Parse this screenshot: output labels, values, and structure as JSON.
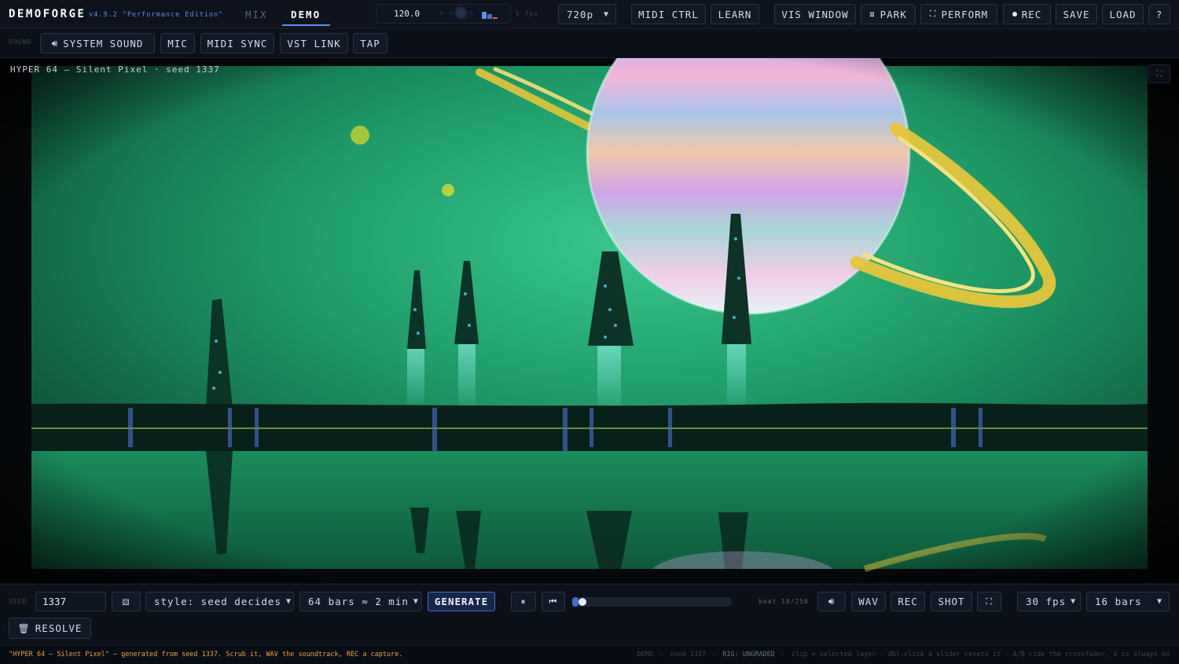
{
  "app": {
    "name": "DEMOFORGE",
    "version": "v4.9.2 \"Performance Edition\""
  },
  "mode_tabs": [
    {
      "label": "MIX",
      "active": false
    },
    {
      "label": "DEMO",
      "active": true
    }
  ],
  "tempo": {
    "bpm": "120.0",
    "fps_readout": "5 fps"
  },
  "resolution": {
    "selected": "720p"
  },
  "top_buttons": {
    "midi_ctrl": "MIDI CTRL",
    "learn": "LEARN",
    "vis_window": "VIS WINDOW",
    "park": "PARK",
    "perform": "PERFORM",
    "rec": "REC",
    "save": "SAVE",
    "load": "LOAD",
    "help": "?"
  },
  "sound_row": {
    "label": "SOUND",
    "system_sound": "SYSTEM SOUND",
    "mic": "MIC",
    "midi_sync": "MIDI SYNC",
    "vst_link": "VST LINK",
    "tap": "TAP"
  },
  "stage": {
    "caption": "HYPER 64 — Silent Pixel · seed 1337"
  },
  "controls": {
    "seed_label": "SEED",
    "seed_value": "1337",
    "style_selected": "style: seed decides",
    "length_selected": "64 bars ≈ 2 min",
    "generate": "GENERATE",
    "progress": 0.04,
    "beat_readout": "beat 10/256",
    "wav": "WAV",
    "rec": "REC",
    "shot": "SHOT",
    "fps_selected": "30 fps",
    "bars_selected": "16 bars",
    "resolve": "RESOLVE"
  },
  "status": {
    "message": "\"HYPER 64 — Silent Pixel\" — generated from seed 1337. Scrub it, WAV the soundtrack, REC a capture.",
    "mode": "DEMO",
    "seed": "seed 1337",
    "rig": "RIG: UNGRADED",
    "hint": "clip = selected layer · dbl-click a slider resets it · A/B ride the crossfader, X is always on"
  },
  "colors": {
    "accent": "#5b8fe8",
    "status_message": "#e8a341",
    "scene_green": "#1f9d6a",
    "ring": "#e6c53a"
  }
}
